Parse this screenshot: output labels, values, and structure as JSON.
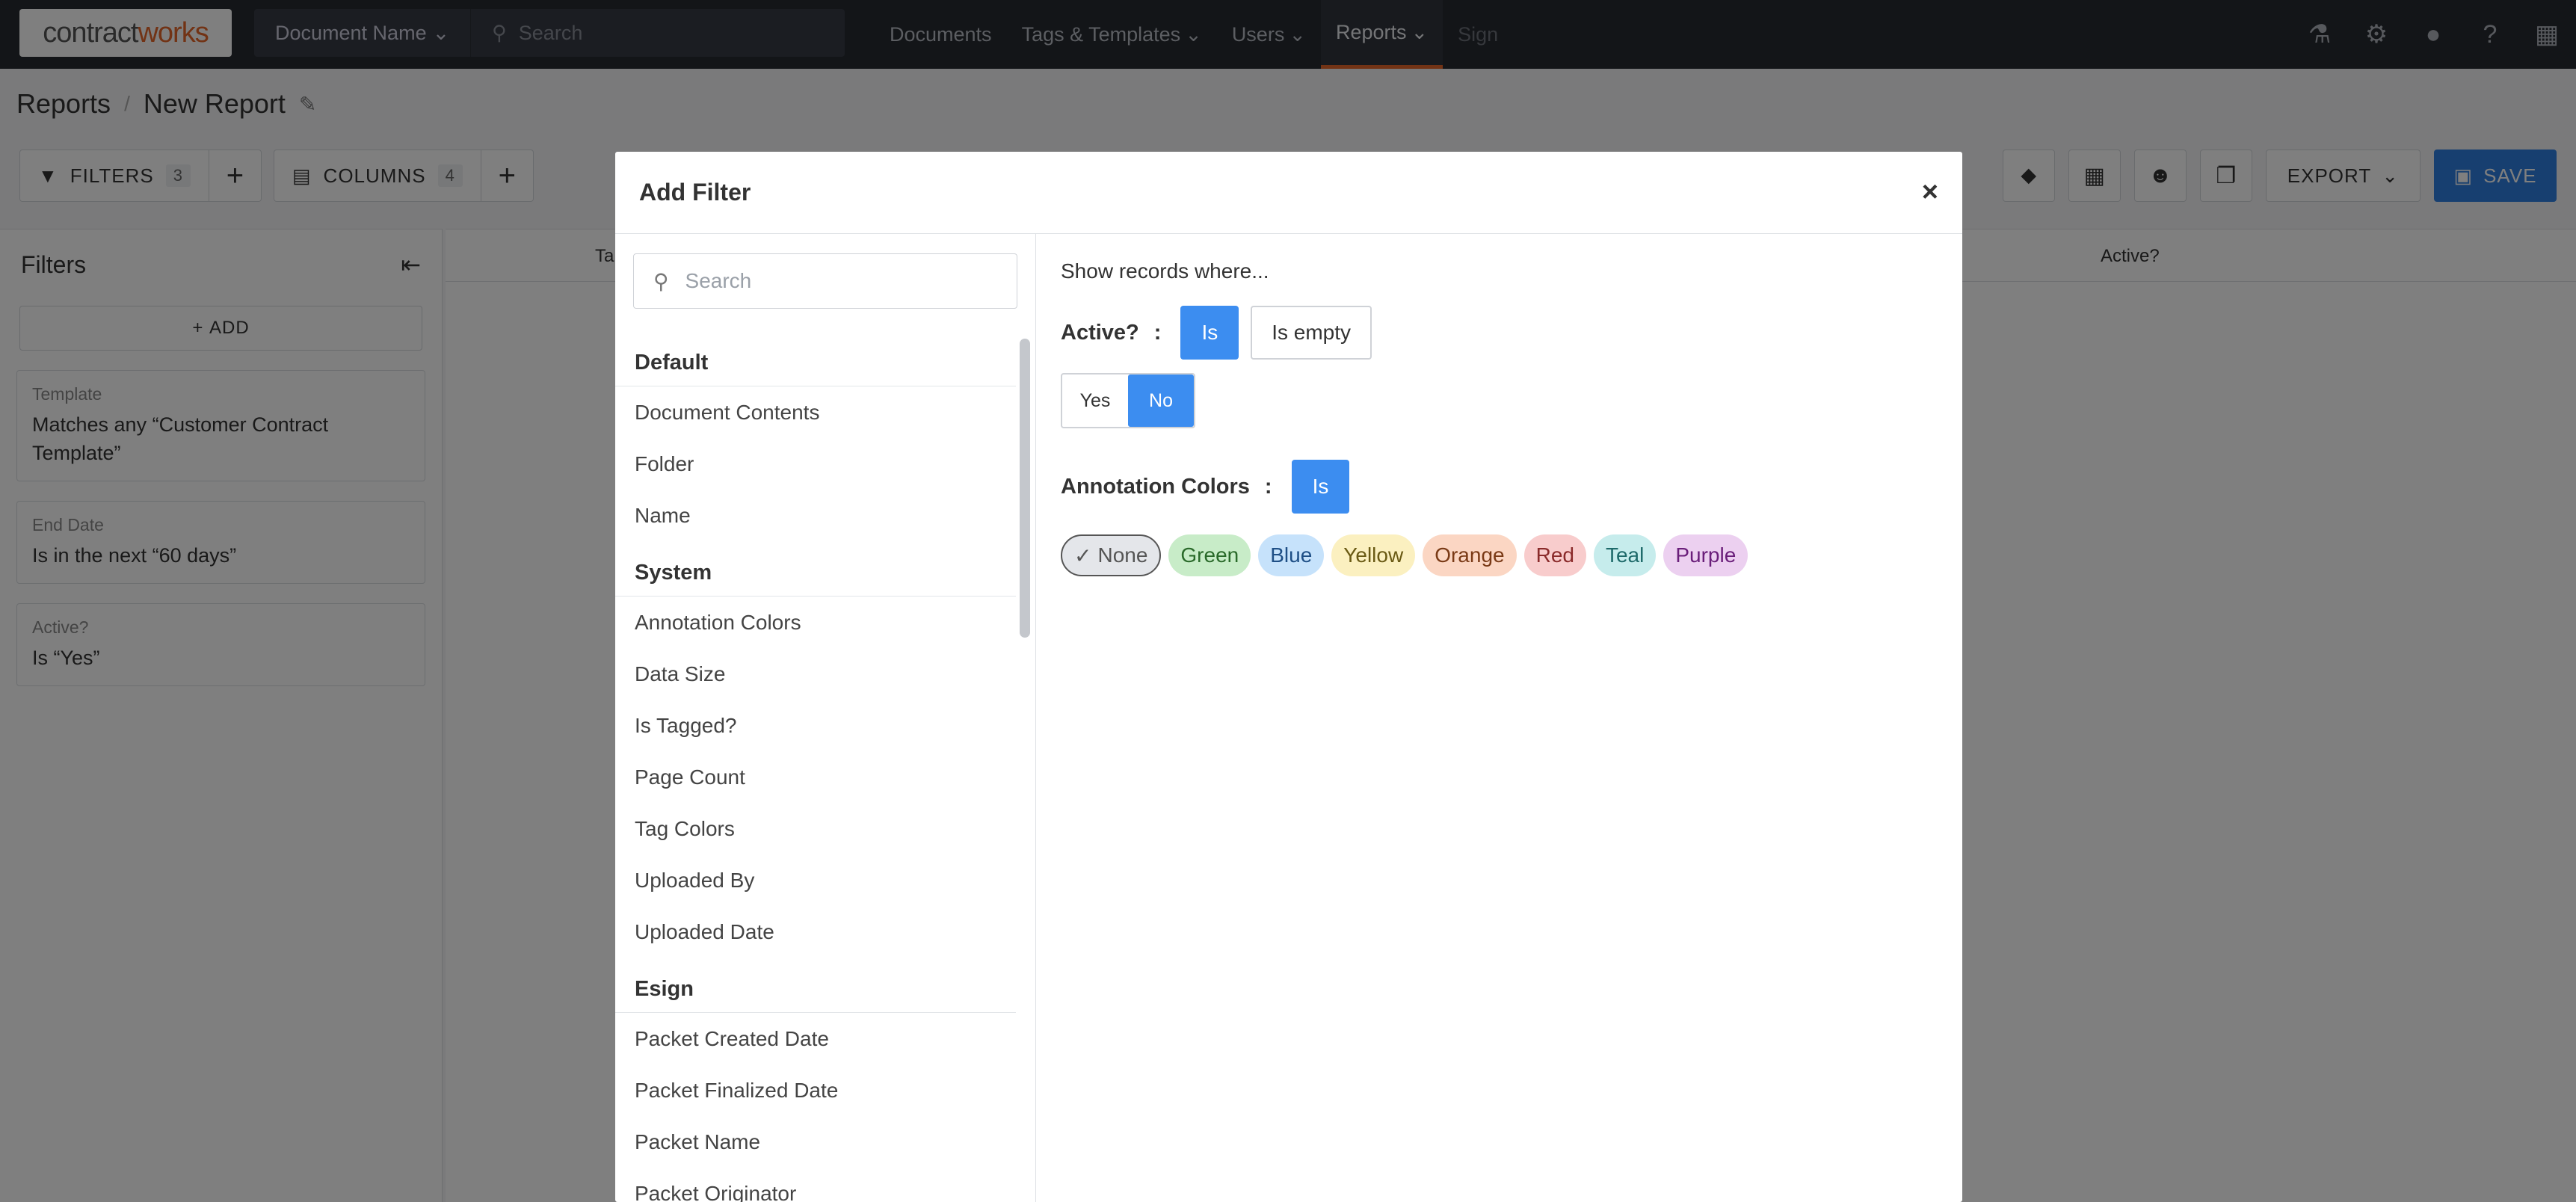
{
  "nav": {
    "logo_a": "contract",
    "logo_b": "works",
    "document_name": "Document Name",
    "search_placeholder": "Search",
    "links": [
      "Documents",
      "Tags & Templates",
      "Users",
      "Reports",
      "Sign"
    ]
  },
  "header": {
    "crumb_root": "Reports",
    "crumb_current": "New Report"
  },
  "toolbar": {
    "filters_label": "FILTERS",
    "filters_count": "3",
    "columns_label": "COLUMNS",
    "columns_count": "4",
    "export_label": "EXPORT",
    "save_label": "SAVE"
  },
  "sidebar": {
    "title": "Filters",
    "add_label": "ADD",
    "filters": [
      {
        "title": "Template",
        "value": "Matches any “Customer Contract Template”"
      },
      {
        "title": "End Date",
        "value": "Is in the next “60 days”"
      },
      {
        "title": "Active?",
        "value": "Is “Yes”"
      }
    ]
  },
  "table": {
    "col1": "Ta",
    "col2": "Active?"
  },
  "modal": {
    "title": "Add Filter",
    "close": "×",
    "search_placeholder": "Search",
    "groups": [
      {
        "name": "Default",
        "items": [
          "Document Contents",
          "Folder",
          "Name"
        ]
      },
      {
        "name": "System",
        "items": [
          "Annotation Colors",
          "Data Size",
          "Is Tagged?",
          "Page Count",
          "Tag Colors",
          "Uploaded By",
          "Uploaded Date"
        ]
      },
      {
        "name": "Esign",
        "items": [
          "Packet Created Date",
          "Packet Finalized Date",
          "Packet Name",
          "Packet Originator"
        ]
      }
    ],
    "intro": "Show records where...",
    "active_label": "Active?",
    "colon": ":",
    "op_is": "Is",
    "op_empty": "Is empty",
    "yes": "Yes",
    "no": "No",
    "annotation_label": "Annotation Colors",
    "colors": [
      {
        "name": "None",
        "bg": "#e4e6ea",
        "fg": "#555555",
        "border": "#555555",
        "checked": true
      },
      {
        "name": "Green",
        "bg": "#c8ecc8",
        "fg": "#2a6a2a"
      },
      {
        "name": "Blue",
        "bg": "#c6e2fb",
        "fg": "#1e4f86"
      },
      {
        "name": "Yellow",
        "bg": "#fbf0c0",
        "fg": "#6a5a14"
      },
      {
        "name": "Orange",
        "bg": "#fbd6c3",
        "fg": "#7a3a16"
      },
      {
        "name": "Red",
        "bg": "#f8cccc",
        "fg": "#8a2a2a"
      },
      {
        "name": "Teal",
        "bg": "#c6ecec",
        "fg": "#1e6a6a"
      },
      {
        "name": "Purple",
        "bg": "#ecd0f0",
        "fg": "#6a1e7a"
      }
    ]
  }
}
